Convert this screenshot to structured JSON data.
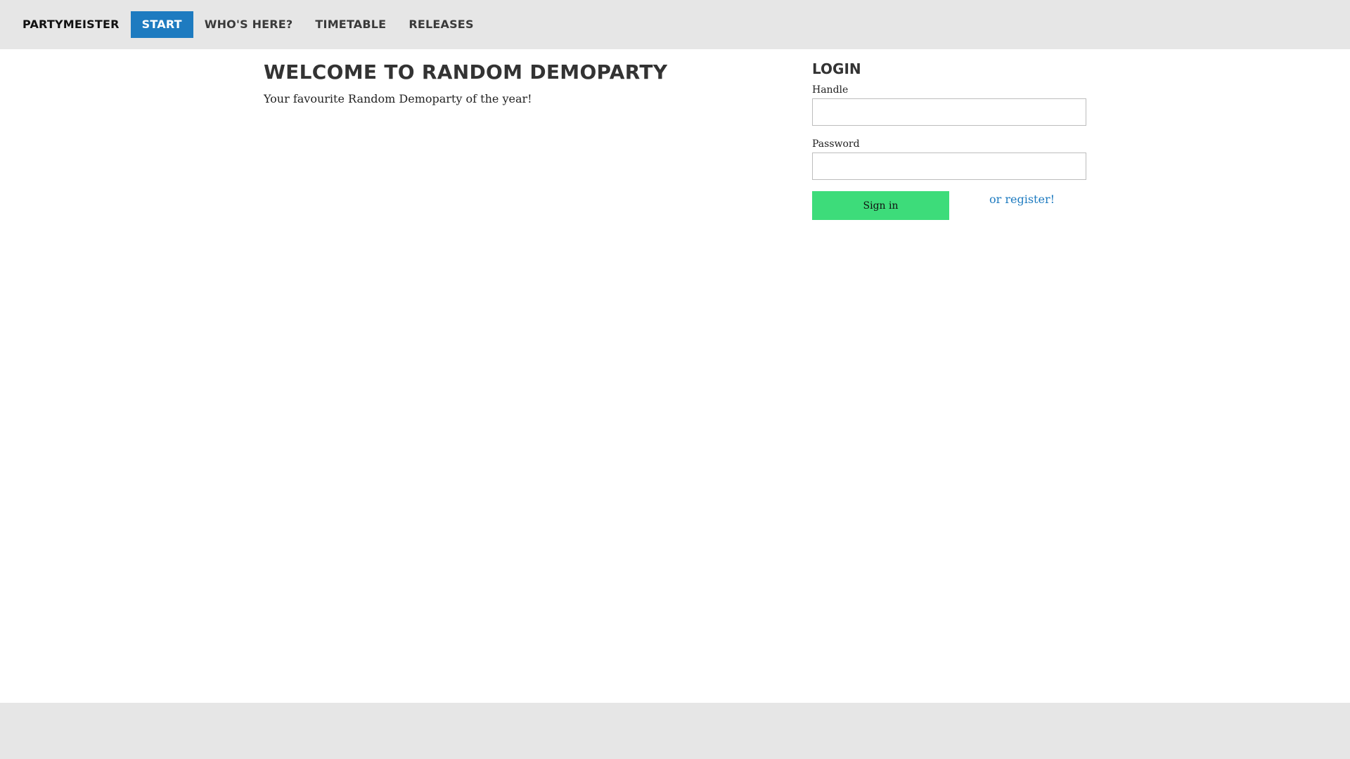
{
  "nav": {
    "brand": "PARTYMEISTER",
    "items": [
      {
        "label": "START",
        "active": true
      },
      {
        "label": "WHO'S HERE?",
        "active": false
      },
      {
        "label": "TIMETABLE",
        "active": false
      },
      {
        "label": "RELEASES",
        "active": false
      }
    ]
  },
  "welcome": {
    "title": "WELCOME TO RANDOM DEMOPARTY",
    "subtitle": "Your favourite Random Demoparty of the year!"
  },
  "login": {
    "title": "LOGIN",
    "handle_label": "Handle",
    "handle_value": "",
    "password_label": "Password",
    "password_value": "",
    "signin_label": "Sign in",
    "register_label": "or register!"
  },
  "colors": {
    "bar_bg": "#e6e6e6",
    "nav_active": "#1e7bc0",
    "signin_button": "#3ddc7a",
    "link": "#1e7bc0"
  }
}
